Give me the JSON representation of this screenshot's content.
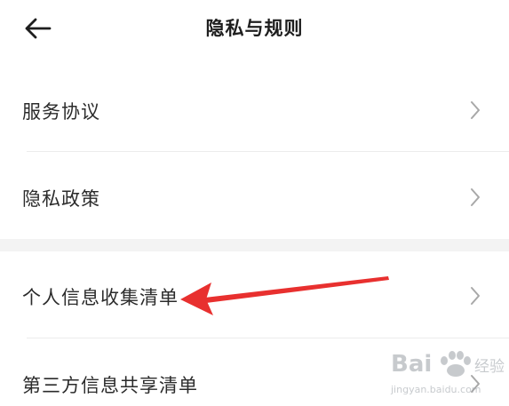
{
  "header": {
    "title": "隐私与规则",
    "back_icon": "arrow-left-icon"
  },
  "menu": {
    "items": [
      {
        "label": "服务协议"
      },
      {
        "label": "隐私政策"
      },
      {
        "label": "个人信息收集清单"
      },
      {
        "label": "第三方信息共享清单"
      }
    ],
    "chevron_icon": "chevron-right-icon"
  },
  "annotation": {
    "arrow_color": "#e8302f"
  },
  "watermark": {
    "brand": "Bai",
    "brand2": "经验",
    "url": "jingyan.baidu.com"
  }
}
